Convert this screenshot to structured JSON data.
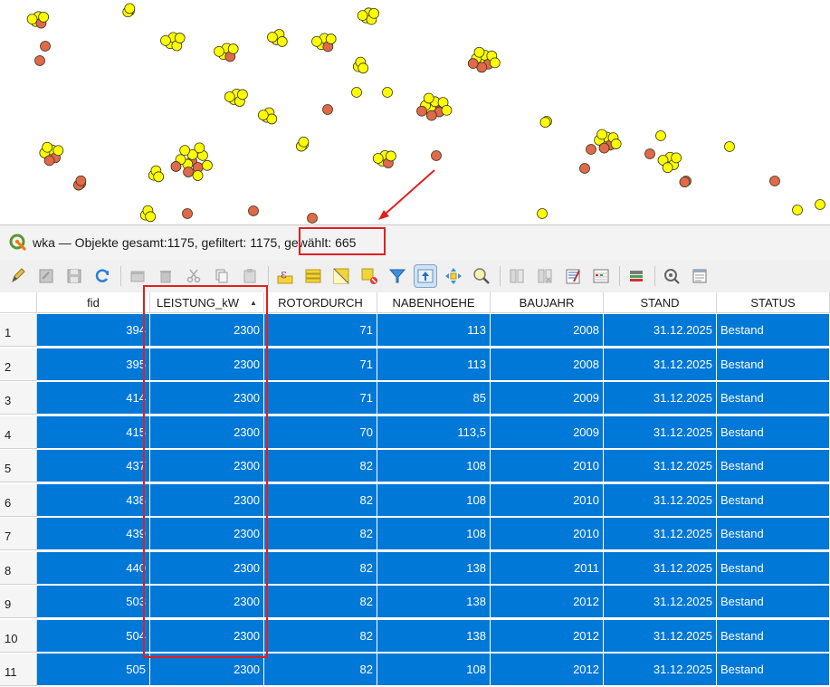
{
  "window": {
    "title": "wka — Objekte gesamt:1175, gefiltert: 1175, gewählt: 665"
  },
  "toolbar": {
    "icons": [
      "pencil-icon",
      "save-edits-icon",
      "save-icon",
      "reload-icon",
      "add-feature-icon",
      "delete-icon",
      "cut-icon",
      "copy-icon",
      "paste-icon",
      "expression-select-icon",
      "select-all-icon",
      "invert-selection-icon",
      "deselect-icon",
      "filter-icon",
      "move-selection-top-icon",
      "pan-to-selection-icon",
      "zoom-to-selection-icon",
      "new-field-icon",
      "delete-field-icon",
      "field-calculator-icon",
      "conditional-format-icon",
      "dock-icon",
      "actions-icon",
      "form-view-icon"
    ]
  },
  "table": {
    "columns": [
      "fid",
      "LEISTUNG_kW",
      "ROTORDURCH",
      "NABENHOEHE",
      "BAUJAHR",
      "STAND",
      "STATUS"
    ],
    "sort_column": "LEISTUNG_kW",
    "rows": [
      {
        "n": "1",
        "fid": "394",
        "leistung": "2300",
        "rotor": "71",
        "nabe": "113",
        "baujahr": "2008",
        "stand": "31.12.2025",
        "status": "Bestand"
      },
      {
        "n": "2",
        "fid": "395",
        "leistung": "2300",
        "rotor": "71",
        "nabe": "113",
        "baujahr": "2008",
        "stand": "31.12.2025",
        "status": "Bestand"
      },
      {
        "n": "3",
        "fid": "414",
        "leistung": "2300",
        "rotor": "71",
        "nabe": "85",
        "baujahr": "2009",
        "stand": "31.12.2025",
        "status": "Bestand"
      },
      {
        "n": "4",
        "fid": "415",
        "leistung": "2300",
        "rotor": "70",
        "nabe": "113,5",
        "baujahr": "2009",
        "stand": "31.12.2025",
        "status": "Bestand"
      },
      {
        "n": "5",
        "fid": "437",
        "leistung": "2300",
        "rotor": "82",
        "nabe": "108",
        "baujahr": "2010",
        "stand": "31.12.2025",
        "status": "Bestand"
      },
      {
        "n": "6",
        "fid": "438",
        "leistung": "2300",
        "rotor": "82",
        "nabe": "108",
        "baujahr": "2010",
        "stand": "31.12.2025",
        "status": "Bestand"
      },
      {
        "n": "7",
        "fid": "439",
        "leistung": "2300",
        "rotor": "82",
        "nabe": "108",
        "baujahr": "2010",
        "stand": "31.12.2025",
        "status": "Bestand"
      },
      {
        "n": "8",
        "fid": "440",
        "leistung": "2300",
        "rotor": "82",
        "nabe": "138",
        "baujahr": "2011",
        "stand": "31.12.2025",
        "status": "Bestand"
      },
      {
        "n": "9",
        "fid": "503",
        "leistung": "2300",
        "rotor": "82",
        "nabe": "138",
        "baujahr": "2012",
        "stand": "31.12.2025",
        "status": "Bestand"
      },
      {
        "n": "10",
        "fid": "504",
        "leistung": "2300",
        "rotor": "82",
        "nabe": "138",
        "baujahr": "2012",
        "stand": "31.12.2025",
        "status": "Bestand"
      },
      {
        "n": "11",
        "fid": "505",
        "leistung": "2300",
        "rotor": "82",
        "nabe": "108",
        "baujahr": "2012",
        "stand": "31.12.2025",
        "status": "Bestand"
      }
    ]
  },
  "colors": {
    "selected_point": "#ffff00",
    "unselected_point": "#e0684b",
    "selection_highlight": "#0078d7",
    "annotation": "#e41e1e"
  }
}
